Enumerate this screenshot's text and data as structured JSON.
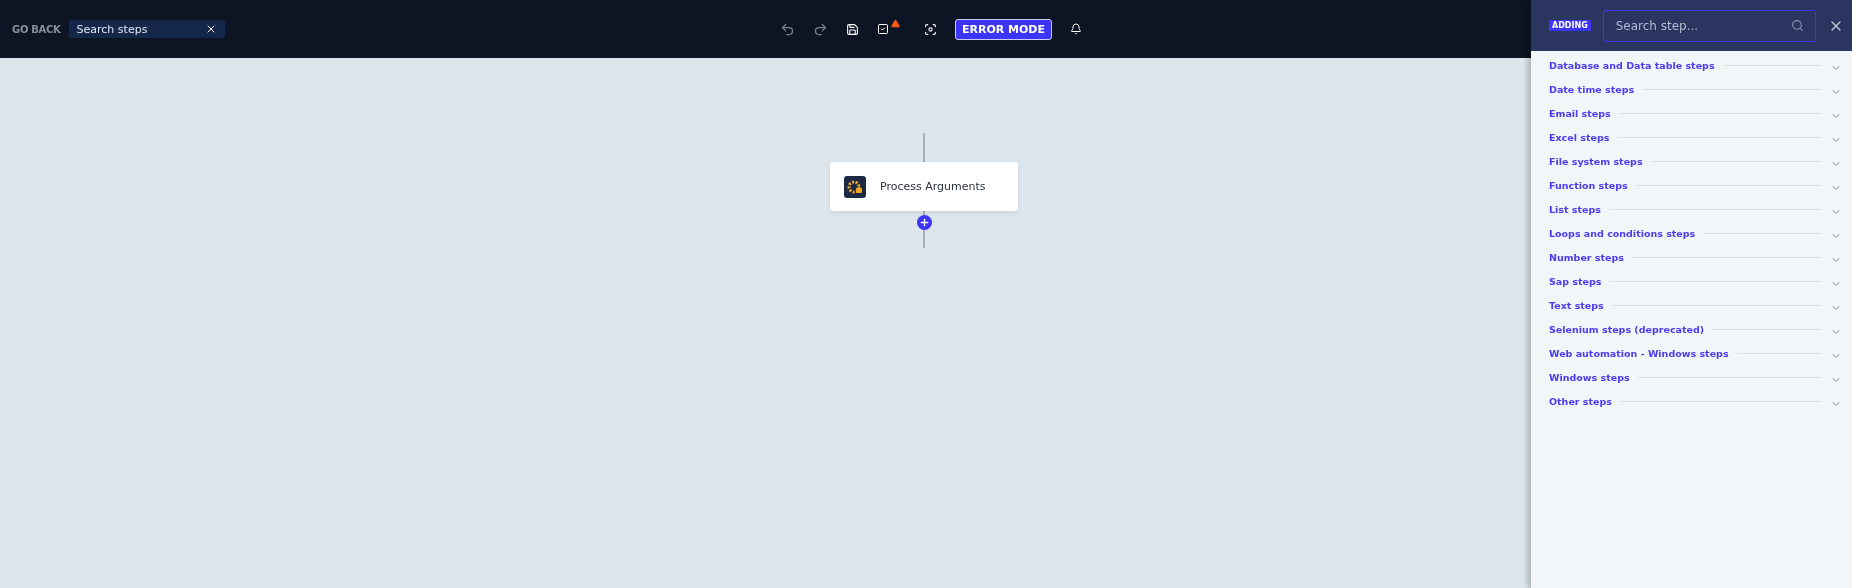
{
  "topbar": {
    "go_back": "GO BACK",
    "search": {
      "value": "Search steps"
    },
    "error_mode": {
      "label": "ERROR MODE",
      "on": true
    }
  },
  "canvas": {
    "nodes": [
      {
        "label": "Process Arguments"
      }
    ]
  },
  "panel": {
    "badge": "ADDING",
    "search": {
      "placeholder": "Search step..."
    },
    "categories": [
      {
        "label": "Database and Data table steps",
        "expanded": false
      },
      {
        "label": "Date time steps",
        "expanded": false
      },
      {
        "label": "Email steps",
        "expanded": false
      },
      {
        "label": "Excel steps",
        "expanded": false
      },
      {
        "label": "File system steps",
        "expanded": false
      },
      {
        "label": "Function steps",
        "expanded": false
      },
      {
        "label": "List steps",
        "expanded": false
      },
      {
        "label": "Loops and conditions steps",
        "expanded": false
      },
      {
        "label": "Number steps",
        "expanded": false
      },
      {
        "label": "Sap steps",
        "expanded": false
      },
      {
        "label": "Text steps",
        "expanded": false
      },
      {
        "label": "Selenium steps (deprecated)",
        "expanded": false
      },
      {
        "label": "Web automation - Windows steps",
        "expanded": false
      },
      {
        "label": "Windows steps",
        "expanded": false
      },
      {
        "label": "Other steps",
        "expanded": false
      }
    ]
  }
}
